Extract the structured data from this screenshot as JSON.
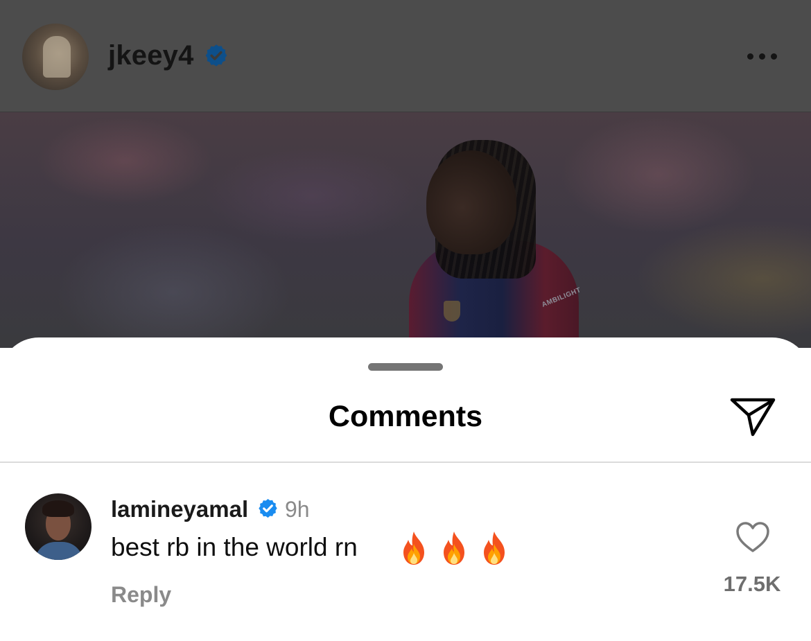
{
  "post": {
    "username": "jkeey4",
    "verified": true,
    "more_icon": "ellipsis-icon",
    "image_overlay_text": "AMBILIGHT"
  },
  "comments_sheet": {
    "title": "Comments",
    "share_icon": "paper-plane-icon"
  },
  "comments": [
    {
      "username": "lamineyamal",
      "verified": true,
      "time": "9h",
      "text": "best rb in the world rn",
      "emojis": [
        "fire",
        "fire",
        "fire"
      ],
      "reply_label": "Reply",
      "like_count": "17.5K",
      "like_icon": "heart-outline-icon"
    }
  ],
  "colors": {
    "verified_blue": "#1a8cf0",
    "dim_overlay": "#4c4c4c",
    "secondary_text": "#8a8a8a"
  }
}
